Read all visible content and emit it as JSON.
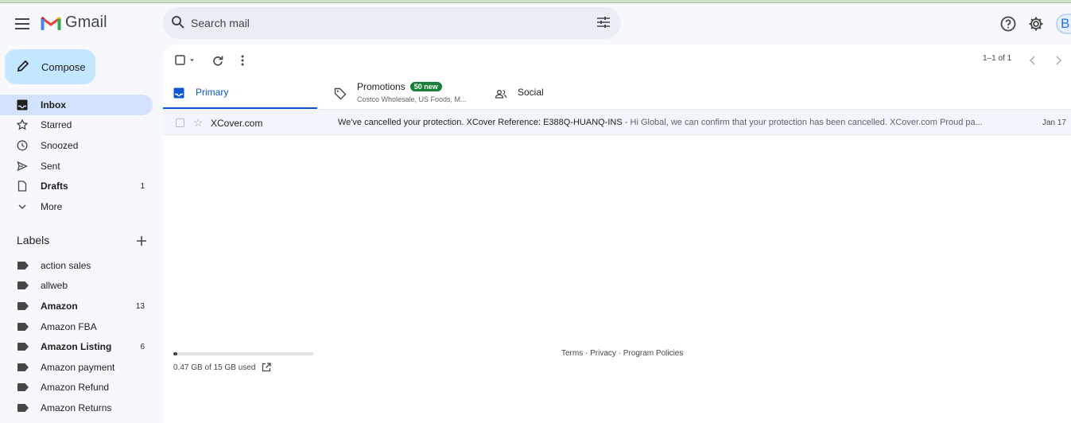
{
  "app": {
    "name": "Gmail"
  },
  "search": {
    "placeholder": "Search mail"
  },
  "header": {
    "avatar_initial": "B"
  },
  "sidebar": {
    "compose_label": "Compose",
    "nav": [
      {
        "label": "Inbox",
        "count": "",
        "icon": "inbox-icon",
        "active": true,
        "bold": true
      },
      {
        "label": "Starred",
        "count": "",
        "icon": "star-icon"
      },
      {
        "label": "Snoozed",
        "count": "",
        "icon": "clock-icon"
      },
      {
        "label": "Sent",
        "count": "",
        "icon": "send-icon"
      },
      {
        "label": "Drafts",
        "count": "1",
        "icon": "draft-icon",
        "bold": true
      },
      {
        "label": "More",
        "count": "",
        "icon": "chevron-down-icon"
      }
    ],
    "labels_title": "Labels",
    "labels": [
      {
        "label": "action sales",
        "count": ""
      },
      {
        "label": "allweb",
        "count": ""
      },
      {
        "label": "Amazon",
        "count": "13",
        "bold": true
      },
      {
        "label": "Amazon FBA",
        "count": ""
      },
      {
        "label": "Amazon Listing",
        "count": "6",
        "bold": true
      },
      {
        "label": "Amazon payment",
        "count": ""
      },
      {
        "label": "Amazon Refund",
        "count": ""
      },
      {
        "label": "Amazon Returns",
        "count": ""
      }
    ]
  },
  "toolbar": {
    "pagination": "1–1 of 1"
  },
  "tabs": {
    "primary": "Primary",
    "promotions": "Promotions",
    "promotions_badge": "50 new",
    "promotions_sub": "Costco Wholesale, US Foods, M...",
    "social": "Social"
  },
  "emails": [
    {
      "sender": "XCover.com",
      "subject": "We've cancelled your protection. XCover Reference: E388Q-HUANQ-INS",
      "snippet": " - Hi Global, we can confirm that your protection has been cancelled. XCover.com Proud pa...",
      "date": "Jan 17"
    }
  ],
  "storage": {
    "text": "0.47 GB of 15 GB used",
    "used_fraction": 0.031
  },
  "footer": {
    "links": "Terms · Privacy · Program Policies"
  },
  "colors": {
    "accent": "#0b57d0",
    "compose_bg": "#c2e7ff",
    "active_nav": "#d3e3fd",
    "badge": "#188038"
  }
}
